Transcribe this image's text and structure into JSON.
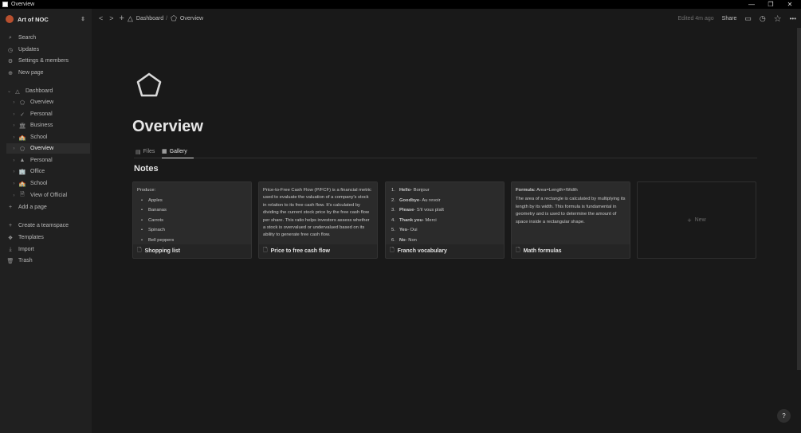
{
  "window": {
    "title": "Overview",
    "minimize": "—",
    "restore": "❐",
    "close": "✕"
  },
  "workspace": {
    "name": "Art of NOC",
    "chevron": "⇕"
  },
  "sidebar": {
    "top_items": [
      {
        "label": "Search",
        "icon": "⌕"
      },
      {
        "label": "Updates",
        "icon": "◷"
      },
      {
        "label": "Settings & members",
        "icon": "⚙"
      },
      {
        "label": "New page",
        "icon": "⊕"
      }
    ],
    "tree": [
      {
        "label": "Dashboard",
        "icon": "△",
        "caret": "⌄"
      },
      {
        "label": "Overview",
        "icon": "⬠",
        "caret": "›"
      },
      {
        "label": "Personal",
        "icon": "✓",
        "caret": "›"
      },
      {
        "label": "Business",
        "icon": "🏛",
        "caret": "›"
      },
      {
        "label": "School",
        "icon": "🏫",
        "caret": "›"
      },
      {
        "label": "Overview",
        "icon": "⬠",
        "caret": "›"
      },
      {
        "label": "Personal",
        "icon": "▲",
        "caret": "›"
      },
      {
        "label": "Office",
        "icon": "🏢",
        "caret": "›"
      },
      {
        "label": "School",
        "icon": "🏫",
        "caret": "›"
      },
      {
        "label": "View of Official",
        "icon": "🗎",
        "caret": "›"
      }
    ],
    "add_page": "Add a page",
    "bottom_items": [
      {
        "label": "Create a teamspace",
        "icon": "+"
      },
      {
        "label": "Templates",
        "icon": "❖"
      },
      {
        "label": "Import",
        "icon": "⤓"
      },
      {
        "label": "Trash",
        "icon": "🗑"
      }
    ]
  },
  "topbar": {
    "back": "<",
    "forward": ">",
    "new": "+",
    "breadcrumb": [
      {
        "label": "Dashboard",
        "icon": "△"
      },
      {
        "label": "Overview",
        "icon": "⬠"
      }
    ],
    "separator": "/",
    "edited": "Edited 4m ago",
    "share": "Share",
    "comments_icon": "▭",
    "history_icon": "◷",
    "favorite_icon": "☆",
    "more_icon": "•••"
  },
  "page": {
    "title": "Overview",
    "tabs": [
      {
        "label": "Files",
        "icon": "▤"
      },
      {
        "label": "Gallery",
        "icon": "▦"
      }
    ],
    "section": "Notes"
  },
  "cards": [
    {
      "title": "Shopping list",
      "intro": "Produce:",
      "items": [
        "Apples",
        "Bananas",
        "Carrots",
        "Spinach",
        "Bell peppers"
      ]
    },
    {
      "title": "Price to free cash flow",
      "text": "Price-to-Free Cash Flow (P/FCF) is a financial metric used to evaluate the valuation of a company's stock in relation to its free cash flow. It's calculated by dividing the current stock price by the free cash flow per share. This ratio helps investors assess whether a stock is overvalued or undervalued based on its ability to generate free cash flow."
    },
    {
      "title": "Franch vocabulary",
      "entries": [
        {
          "num": "1.",
          "en": "Hello",
          "fr": " - Bonjour"
        },
        {
          "num": "2.",
          "en": "Goodbye",
          "fr": " - Au revoir"
        },
        {
          "num": "3.",
          "en": "Please",
          "fr": " - S'il vous plaît"
        },
        {
          "num": "4.",
          "en": "Thank you",
          "fr": " - Merci"
        },
        {
          "num": "5.",
          "en": "Yes",
          "fr": " - Oui"
        },
        {
          "num": "6.",
          "en": "No",
          "fr": " - Non"
        }
      ]
    },
    {
      "title": "Math formulas",
      "formula_label": "Formula:",
      "formula": " Area=Length×Width",
      "text": "The area of a rectangle is calculated by multiplying its length by its width. This formula is fundamental in geometry and is used to determine the amount of space inside a rectangular shape."
    }
  ],
  "new_card": {
    "label": "New",
    "icon": "+"
  },
  "help": "?",
  "doc_icon": "🗋"
}
